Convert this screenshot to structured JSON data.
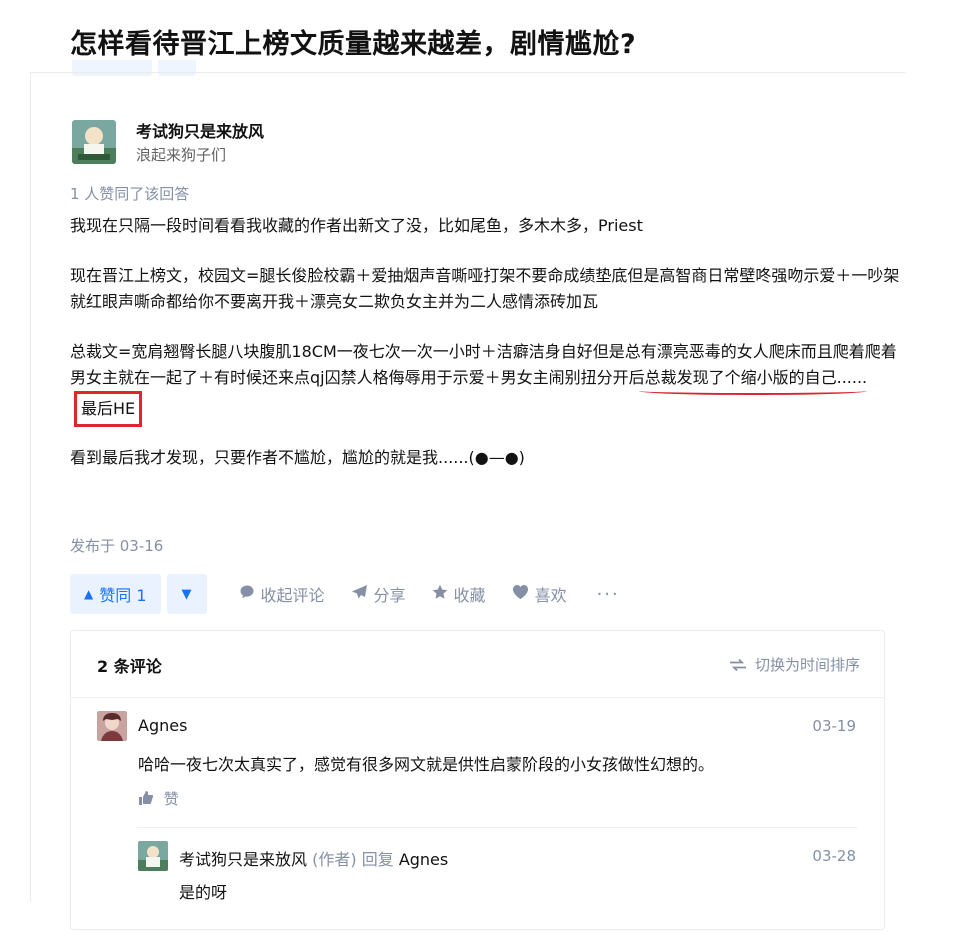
{
  "question": {
    "title": "怎样看待晋江上榜文质量越来越差，剧情尴尬?"
  },
  "answer": {
    "author_name": "考试狗只是来放风",
    "author_headline": "浪起来狗子们",
    "vote_note": "1 人赞同了该回答",
    "para1": "我现在只隔一段时间看看我收藏的作者出新文了没，比如尾鱼，多木木多，Priest",
    "para2": "现在晋江上榜文，校园文=腿长俊脸校霸＋爱抽烟声音嘶哑打架不要命成绩垫底但是高智商日常壁咚强吻示爱＋一吵架就红眼声嘶命都给你不要离开我＋漂亮女二欺负女主并为二人感情添砖加瓦",
    "para3_main": "总裁文=宽肩翘臀长腿八块腹肌18CM一夜七次一次一小时＋洁癖洁身自好但是总有漂亮恶毒的女人爬床而且爬着爬着男女主就在一起了＋有时候还来点qj囚禁人格侮辱用于示爱＋男女主闹别扭分开后",
    "para3_underlined": "总裁发现了个缩小版的自己......",
    "para3_boxed": "最后HE",
    "para4": "看到最后我才发现，只要作者不尴尬，尴尬的就是我......(●—●)",
    "published": "发布于 03-16"
  },
  "actions": {
    "vote_up_label": "赞同 1",
    "vote_up_icon": "▲",
    "vote_down_icon": "▼",
    "collapse_comments": "收起评论",
    "share": "分享",
    "favorite": "收藏",
    "like": "喜欢",
    "more": "···"
  },
  "comments": {
    "count_label": "2 条评论",
    "sort_label": "切换为时间排序",
    "items": [
      {
        "name": "Agnes",
        "date": "03-19",
        "text": "哈哈一夜七次太真实了，感觉有很多网文就是供性启蒙阶段的小女孩做性幻想的。",
        "like": "赞"
      },
      {
        "name": "考试狗只是来放风",
        "tag": "(作者)",
        "reply_word": "回复",
        "reply_to": "Agnes",
        "date": "03-28",
        "text": "是的呀"
      }
    ]
  },
  "colors": {
    "accent": "#1772f6",
    "highlight_red": "#e0252f"
  }
}
